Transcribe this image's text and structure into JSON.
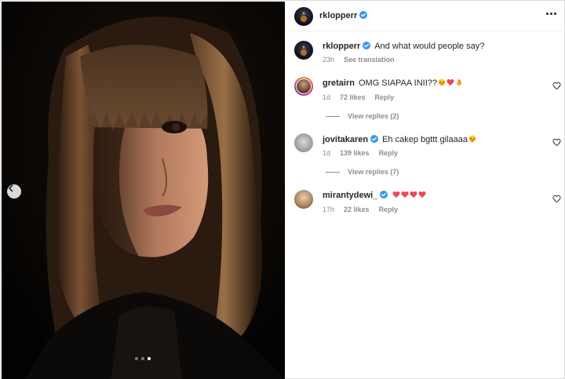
{
  "post": {
    "author": "rklopperr",
    "carousel": {
      "total": 3,
      "active_index": 2
    }
  },
  "caption": {
    "username": "rklopperr",
    "text": "And what would people say?",
    "time": "23h",
    "see_translation": "See translation"
  },
  "comments": [
    {
      "username": "gretairn",
      "text": "OMG SIAPAA INII??",
      "emojis": [
        "star-struck-emoji",
        "red-heart-emoji",
        "fire-emoji"
      ],
      "time": "1d",
      "likes": "72 likes",
      "reply": "Reply",
      "view_replies": "View replies (2)"
    },
    {
      "username": "jovitakaren",
      "text": "Eh cakep bgttt gilaaaa",
      "emojis": [
        "star-struck-emoji"
      ],
      "time": "1d",
      "likes": "139 likes",
      "reply": "Reply",
      "view_replies": "View replies (7)"
    },
    {
      "username": "mirantydewi_",
      "text": "",
      "emojis": [
        "red-heart-emoji",
        "red-heart-emoji",
        "red-heart-emoji",
        "red-heart-emoji"
      ],
      "time": "17h",
      "likes": "22 likes",
      "reply": "Reply"
    }
  ],
  "colors": {
    "verified_blue": "#3897f0",
    "heart_red": "#ed4956",
    "secondary_text": "#8e8e8e"
  }
}
